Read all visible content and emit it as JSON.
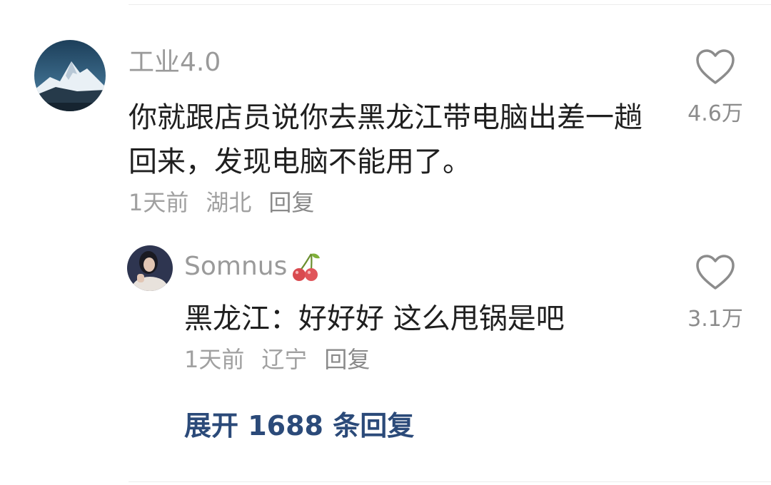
{
  "comment": {
    "username": "工业4.0",
    "text": "你就跟店员说你去黑龙江带电脑出差一趟回来，发现电脑不能用了。",
    "time": "1天前",
    "location": "湖北",
    "reply_label": "回复",
    "likes": "4.6万",
    "avatar_icon": "mountain-avatar-icon"
  },
  "reply": {
    "username": "Somnus",
    "username_emoji_icon": "cherry-icon",
    "text": "黑龙江：好好好 这么甩锅是吧",
    "time": "1天前",
    "location": "辽宁",
    "reply_label": "回复",
    "likes": "3.1万",
    "avatar_icon": "person-avatar-icon"
  },
  "expand": {
    "label": "展开 1688 条回复"
  },
  "colors": {
    "text": "#1f1f1f",
    "muted": "#9a9a9a",
    "link": "#2b4a79"
  }
}
